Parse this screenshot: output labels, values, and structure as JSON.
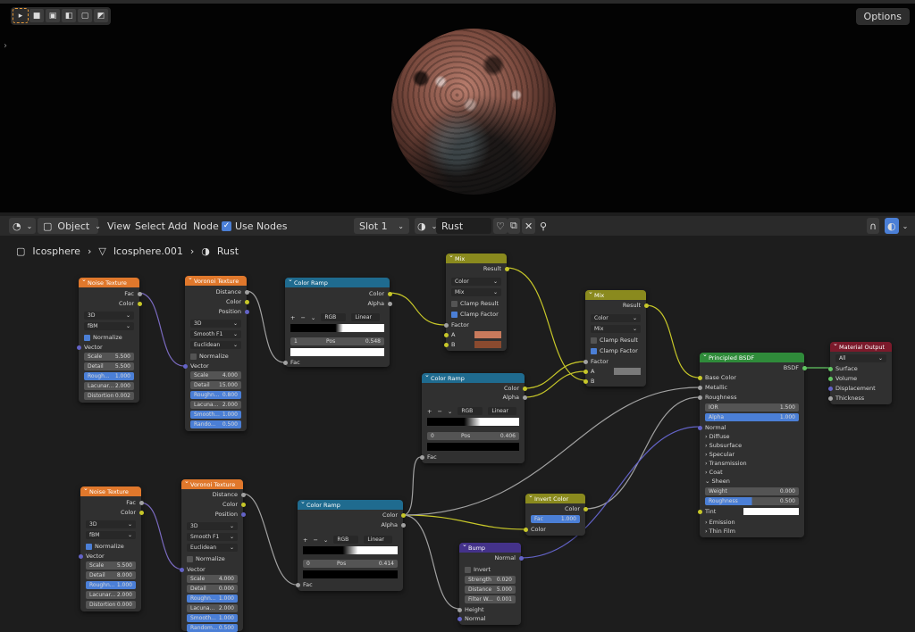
{
  "viewport": {
    "options_label": "Options"
  },
  "header": {
    "mode": "Object",
    "menus": [
      "View",
      "Select",
      "Add",
      "Node"
    ],
    "use_nodes": "Use Nodes",
    "slot": "Slot 1",
    "material": "Rust"
  },
  "breadcrumb": [
    "Icosphere",
    "Icosphere.001",
    "Rust"
  ],
  "nodes": {
    "noise1": {
      "title": "Noise Texture",
      "out": [
        "Fac",
        "Color"
      ],
      "dim": "3D",
      "type": "fBM",
      "normalize": "Normalize",
      "vector": "Vector",
      "fields": [
        [
          "Scale",
          "5.500"
        ],
        [
          "Detail",
          "5.500"
        ],
        [
          "Rough...",
          "1.000"
        ],
        [
          "Lacunar...",
          "2.000"
        ],
        [
          "Distortion",
          "0.002"
        ]
      ]
    },
    "voronoi1": {
      "title": "Voronoi Texture",
      "out": [
        "Distance",
        "Color",
        "Position"
      ],
      "dim": "3D",
      "feature": "Smooth F1",
      "metric": "Euclidean",
      "normalize": "Normalize",
      "vector": "Vector",
      "fields": [
        [
          "Scale",
          "4.000"
        ],
        [
          "Detail",
          "15.000"
        ],
        [
          "Roughn...",
          "0.800"
        ],
        [
          "Lacuna...",
          "2.000"
        ],
        [
          "Smooth...",
          "1.000"
        ],
        [
          "Rando...",
          "0.500"
        ]
      ]
    },
    "ramp1": {
      "title": "Color Ramp",
      "out": [
        "Color",
        "Alpha"
      ],
      "mode": "RGB",
      "interp": "Linear",
      "index": "1",
      "pos_label": "Pos",
      "pos": "0.548",
      "fac": "Fac"
    },
    "mix1": {
      "title": "Mix",
      "out": "Result",
      "dtype": "Color",
      "blend": "Mix",
      "clamp_result": "Clamp Result",
      "clamp_factor": "Clamp Factor",
      "factor": "Factor",
      "a": "A",
      "b": "B",
      "a_color": "#c87a5c",
      "b_color": "#8a4a2f"
    },
    "mix2": {
      "title": "Mix",
      "out": "Result",
      "dtype": "Color",
      "blend": "Mix",
      "clamp_result": "Clamp Result",
      "clamp_factor": "Clamp Factor",
      "factor": "Factor",
      "a": "A",
      "b": "B",
      "a_color": "#7a7a7a"
    },
    "ramp2": {
      "title": "Color Ramp",
      "out": [
        "Color",
        "Alpha"
      ],
      "mode": "RGB",
      "interp": "Linear",
      "index": "0",
      "pos_label": "Pos",
      "pos": "0.406",
      "fac": "Fac"
    },
    "bsdf": {
      "title": "Principled BSDF",
      "out": "BSDF",
      "inputs": [
        "Base Color",
        "Metallic",
        "Roughness"
      ],
      "ior": [
        "IOR",
        "1.500"
      ],
      "alpha": [
        "Alpha",
        "1.000"
      ],
      "normal": "Normal",
      "panels": [
        "Diffuse",
        "Subsurface",
        "Specular",
        "Transmission",
        "Coat",
        "Sheen"
      ],
      "sheen": [
        [
          "Weight",
          "0.000"
        ],
        [
          "Roughness",
          "0.500"
        ]
      ],
      "tint": "Tint",
      "panels2": [
        "Emission",
        "Thin Film"
      ]
    },
    "output": {
      "title": "Material Output",
      "target": "All",
      "inputs": [
        "Surface",
        "Volume",
        "Displacement",
        "Thickness"
      ]
    },
    "noise2": {
      "title": "Noise Texture",
      "out": [
        "Fac",
        "Color"
      ],
      "dim": "3D",
      "type": "fBM",
      "normalize": "Normalize",
      "vector": "Vector",
      "fields": [
        [
          "Scale",
          "5.500"
        ],
        [
          "Detail",
          "8.000"
        ],
        [
          "Roughn...",
          "1.000"
        ],
        [
          "Lacunar...",
          "2.000"
        ],
        [
          "Distortion",
          "0.000"
        ]
      ]
    },
    "voronoi2": {
      "title": "Voronoi Texture",
      "out": [
        "Distance",
        "Color",
        "Position"
      ],
      "dim": "3D",
      "feature": "Smooth F1",
      "metric": "Euclidean",
      "normalize": "Normalize",
      "vector": "Vector",
      "fields": [
        [
          "Scale",
          "4.000"
        ],
        [
          "Detail",
          "0.000"
        ],
        [
          "Roughn...",
          "1.000"
        ],
        [
          "Lacuna...",
          "2.000"
        ],
        [
          "Smooth...",
          "1.000"
        ],
        [
          "Random...",
          "0.500"
        ]
      ]
    },
    "ramp3": {
      "title": "Color Ramp",
      "out": [
        "Color",
        "Alpha"
      ],
      "mode": "RGB",
      "interp": "Linear",
      "index": "0",
      "pos_label": "Pos",
      "pos": "0.414",
      "fac": "Fac"
    },
    "invert": {
      "title": "Invert Color",
      "out": "Color",
      "fac": [
        "Fac",
        "1.000"
      ],
      "color": "Color"
    },
    "bump": {
      "title": "Bump",
      "out": "Normal",
      "invert": "Invert",
      "fields": [
        [
          "Strength",
          "0.020"
        ],
        [
          "Distance",
          "5.000"
        ],
        [
          "Filter W...",
          "0.001"
        ]
      ],
      "height": "Height",
      "normal": "Normal"
    }
  }
}
